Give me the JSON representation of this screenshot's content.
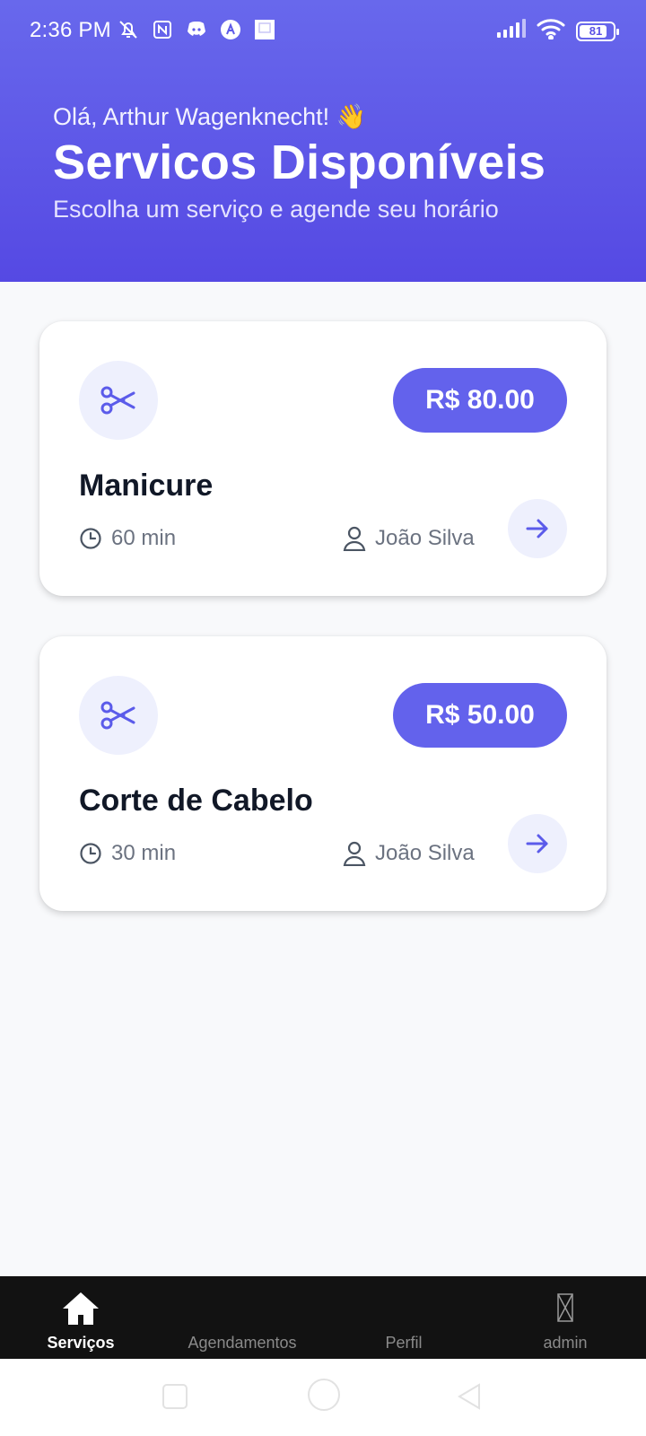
{
  "status_bar": {
    "time": "2:36 PM",
    "battery": "81"
  },
  "header": {
    "greeting": "Olá, Arthur Wagenknecht! 👋",
    "title": "Servicos Disponíveis",
    "subtitle": "Escolha um serviço e agende seu horário"
  },
  "services": [
    {
      "name": "Manicure",
      "price": "R$ 80.00",
      "duration": "60 min",
      "provider": "João Silva",
      "icon": "scissors-icon"
    },
    {
      "name": "Corte de Cabelo",
      "price": "R$ 50.00",
      "duration": "30 min",
      "provider": "João Silva",
      "icon": "scissors-icon"
    }
  ],
  "bottom_nav": {
    "items": [
      {
        "label": "Serviços",
        "icon": "home-icon",
        "active": true
      },
      {
        "label": "Agendamentos",
        "icon": "calendar-icon",
        "active": false
      },
      {
        "label": "Perfil",
        "icon": "user-icon",
        "active": false
      },
      {
        "label": "admin",
        "icon": "missing-icon",
        "active": false
      }
    ]
  },
  "colors": {
    "accent": "#6362ec",
    "header_top": "#6868ec",
    "header_bottom": "#5549e3",
    "nav_bg": "#121212"
  }
}
